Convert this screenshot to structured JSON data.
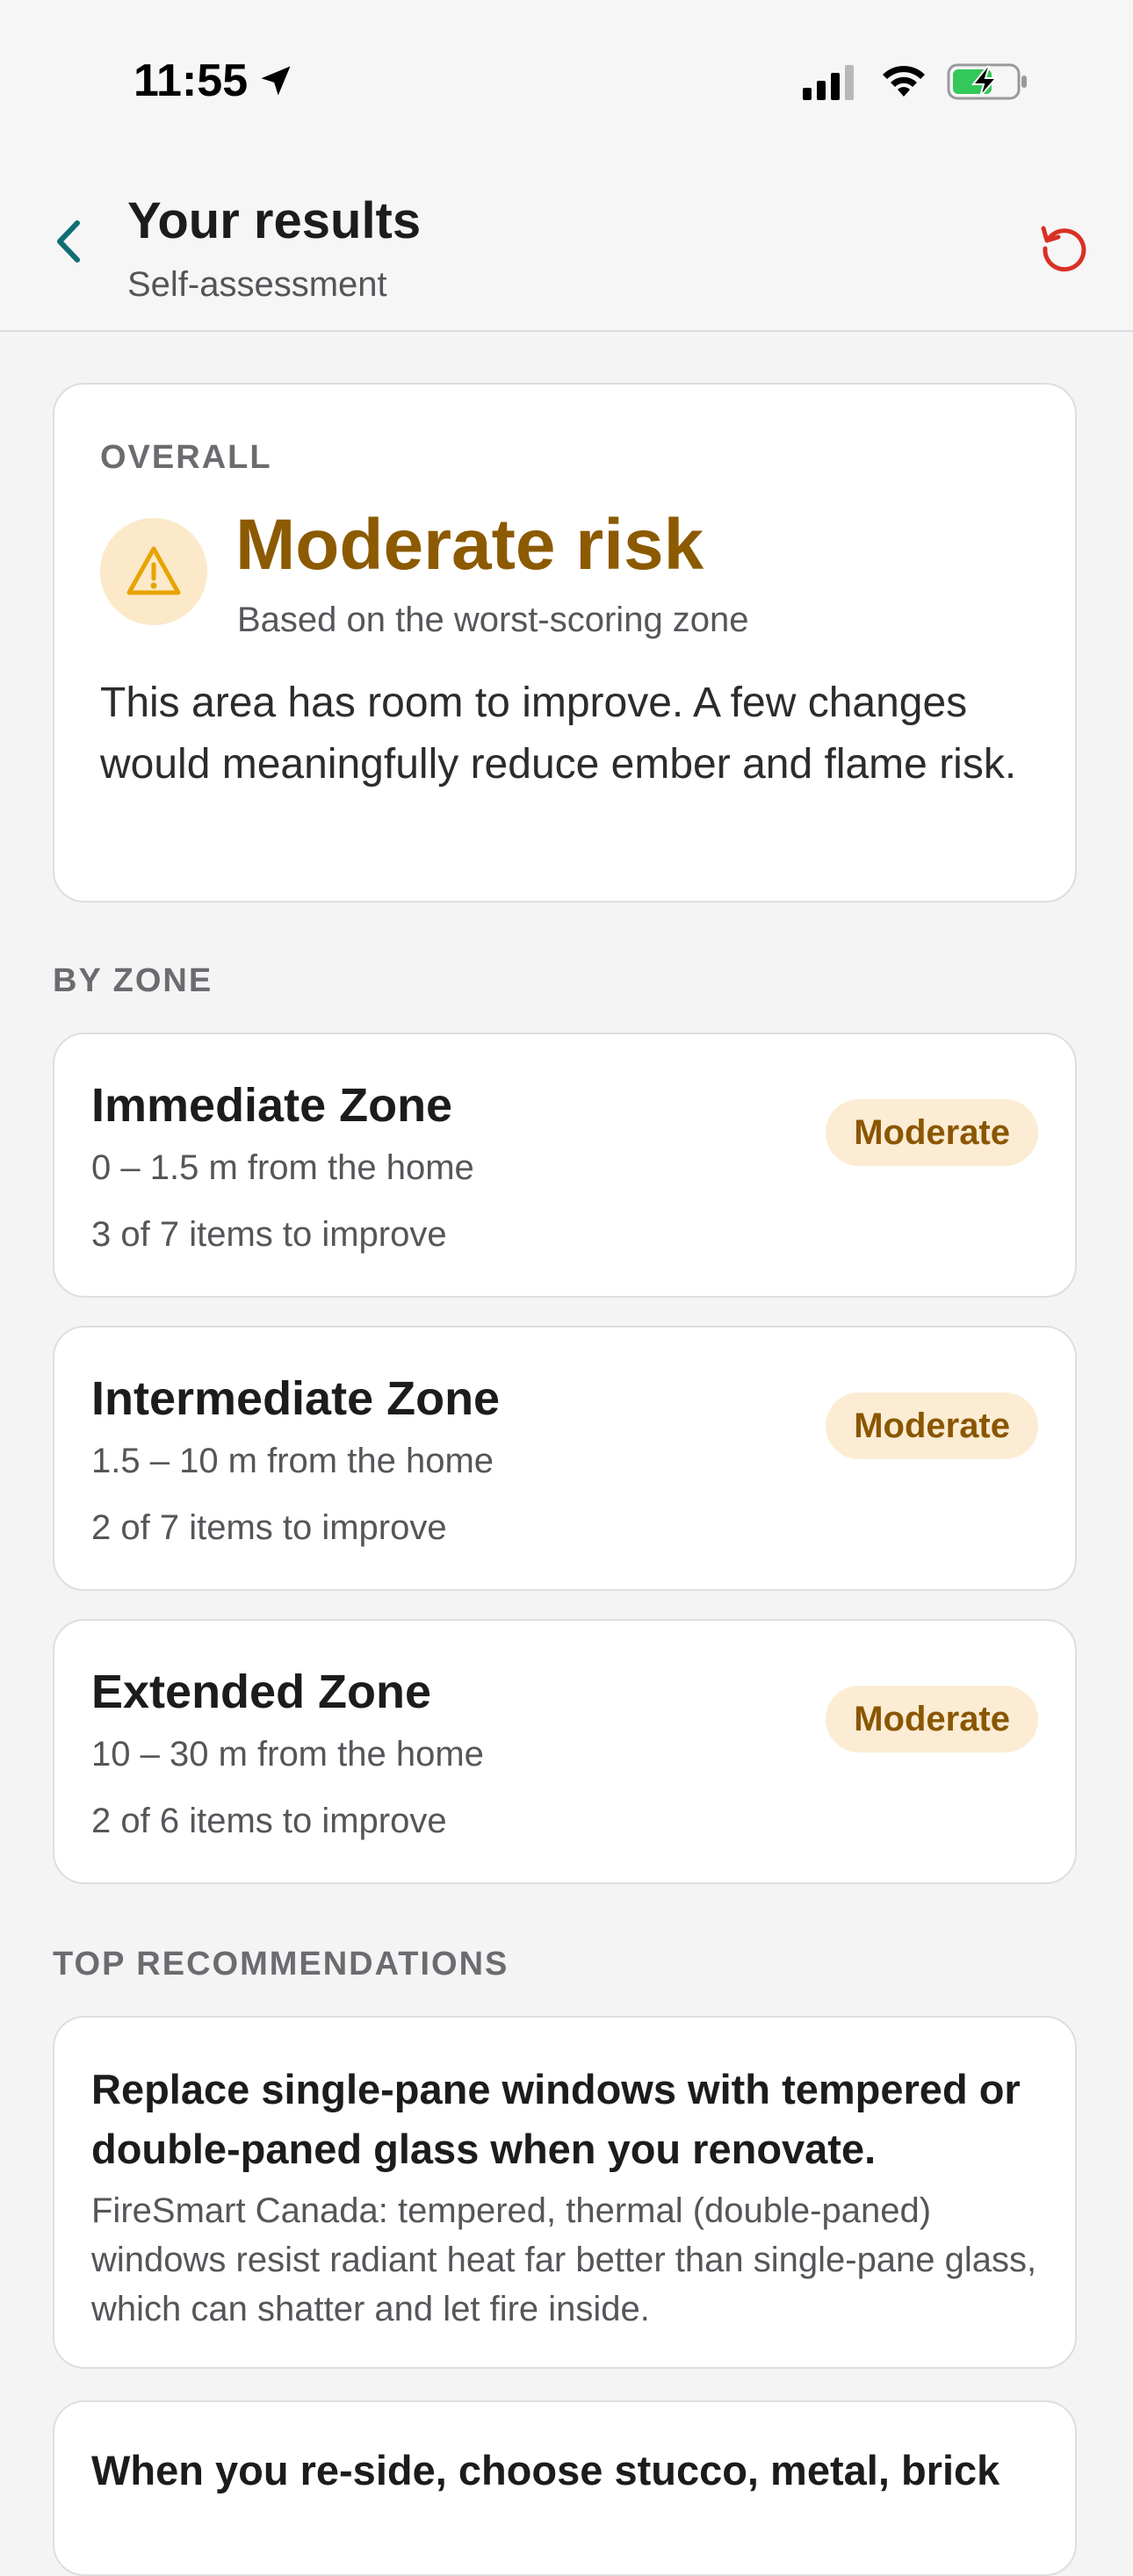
{
  "status_bar": {
    "time": "11:55",
    "icons": [
      "location-arrow-icon",
      "cellular-signal-icon",
      "wifi-icon",
      "battery-charging-icon"
    ]
  },
  "header": {
    "title": "Your results",
    "subtitle": "Self-assessment",
    "back_icon": "chevron-left-icon",
    "reset_icon": "reset-icon"
  },
  "overall": {
    "label": "OVERALL",
    "icon": "warning-triangle-icon",
    "risk": "Moderate risk",
    "basis": "Based on the worst-scoring zone",
    "description": "This area has room to improve. A few changes would meaningfully reduce ember and flame risk."
  },
  "by_zone": {
    "label": "BY ZONE",
    "zones": [
      {
        "name": "Immediate Zone",
        "distance": "0 – 1.5 m from the home",
        "items": "3 of 7 items to improve",
        "rating": "Moderate"
      },
      {
        "name": "Intermediate Zone",
        "distance": "1.5 – 10 m from the home",
        "items": "2 of 7 items to improve",
        "rating": "Moderate"
      },
      {
        "name": "Extended Zone",
        "distance": "10 – 30 m from the home",
        "items": "2 of 6 items to improve",
        "rating": "Moderate"
      }
    ]
  },
  "recommendations": {
    "label": "TOP RECOMMENDATIONS",
    "items": [
      {
        "title": "Replace single-pane windows with tempered or double-paned glass when you renovate.",
        "description": "FireSmart Canada: tempered, thermal (double-paned) windows resist radiant heat far better than single-pane glass, which can shatter and let fire inside."
      },
      {
        "title": "When you re-side, choose stucco, metal, brick"
      }
    ]
  },
  "colors": {
    "accent_teal": "#0f6e73",
    "risk_moderate": "#8c5a00",
    "badge_bg": "#fbecd3",
    "reset_red": "#d93025"
  }
}
